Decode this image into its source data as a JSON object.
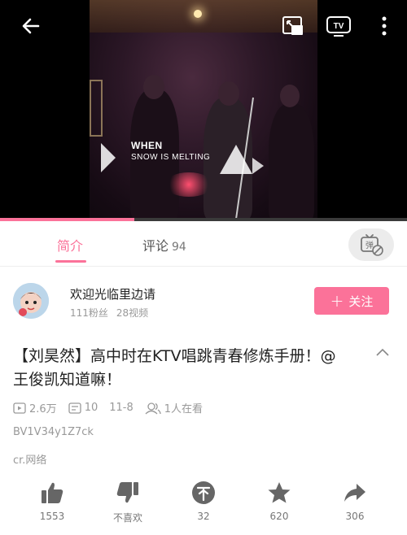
{
  "player": {
    "caption_line1": "WHEN",
    "caption_line2": "SNOW IS MELTING",
    "progress_percent": 33
  },
  "tabs": {
    "intro_label": "简介",
    "comments_label": "评论",
    "comments_count": "94"
  },
  "uploader": {
    "name": "欢迎光临里边请",
    "fans": "111粉丝",
    "videos": "28视频",
    "follow_label": "关注"
  },
  "video": {
    "title": "【刘昊然】高中时在KTV唱跳青春修炼手册！@王俊凯知道嘛！",
    "views": "2.6万",
    "danmaku": "10",
    "date": "11-8",
    "watching": "1人在看",
    "bvid": "BV1V34y1Z7ck",
    "copyright": "cr.网络"
  },
  "actions": {
    "like": "1553",
    "dislike": "不喜欢",
    "coin": "32",
    "favorite": "620",
    "share": "306"
  },
  "colors": {
    "accent": "#fb7299",
    "icon_gray": "#777777"
  }
}
